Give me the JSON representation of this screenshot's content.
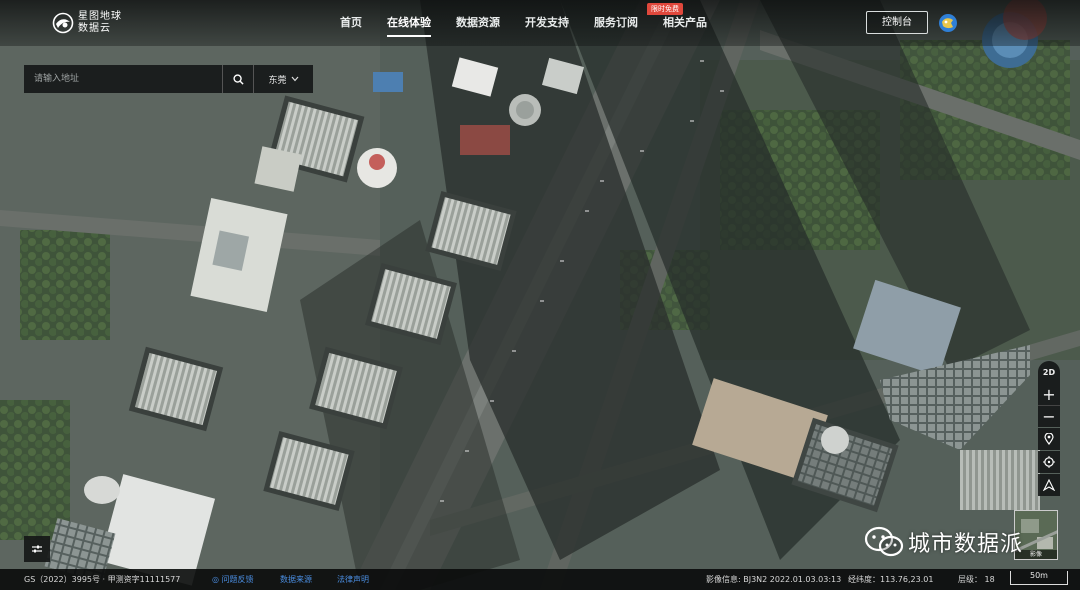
{
  "brand": {
    "name_line1": "星图地球",
    "name_line2": "数据云"
  },
  "nav": {
    "items": [
      "首页",
      "在线体验",
      "数据资源",
      "开发支持",
      "服务订阅",
      "相关产品"
    ],
    "active_index": 1,
    "badge": "限时免费"
  },
  "console_label": "控制台",
  "search": {
    "placeholder": "请输入地址",
    "city": "东莞"
  },
  "tools": {
    "mode_label": "2D",
    "zoom_in": "+",
    "zoom_out": "−"
  },
  "layer_switch_label": "影像",
  "watermark": "城市数据派",
  "status": {
    "license": "GS（2022）3995号 · 甲测资字11111577",
    "links": [
      "问题反馈",
      "数据来源",
      "法律声明"
    ],
    "imagery_info": "影像信息: BJ3N2 2022.01.03.03:13",
    "coords": "经纬度：113.76,23.01",
    "level": "层级： 18",
    "scale": "50m"
  },
  "colors": {
    "accent_link": "#4a8de0",
    "badge_red": "#e0483c",
    "bar_bg": "#0a0b0b"
  }
}
